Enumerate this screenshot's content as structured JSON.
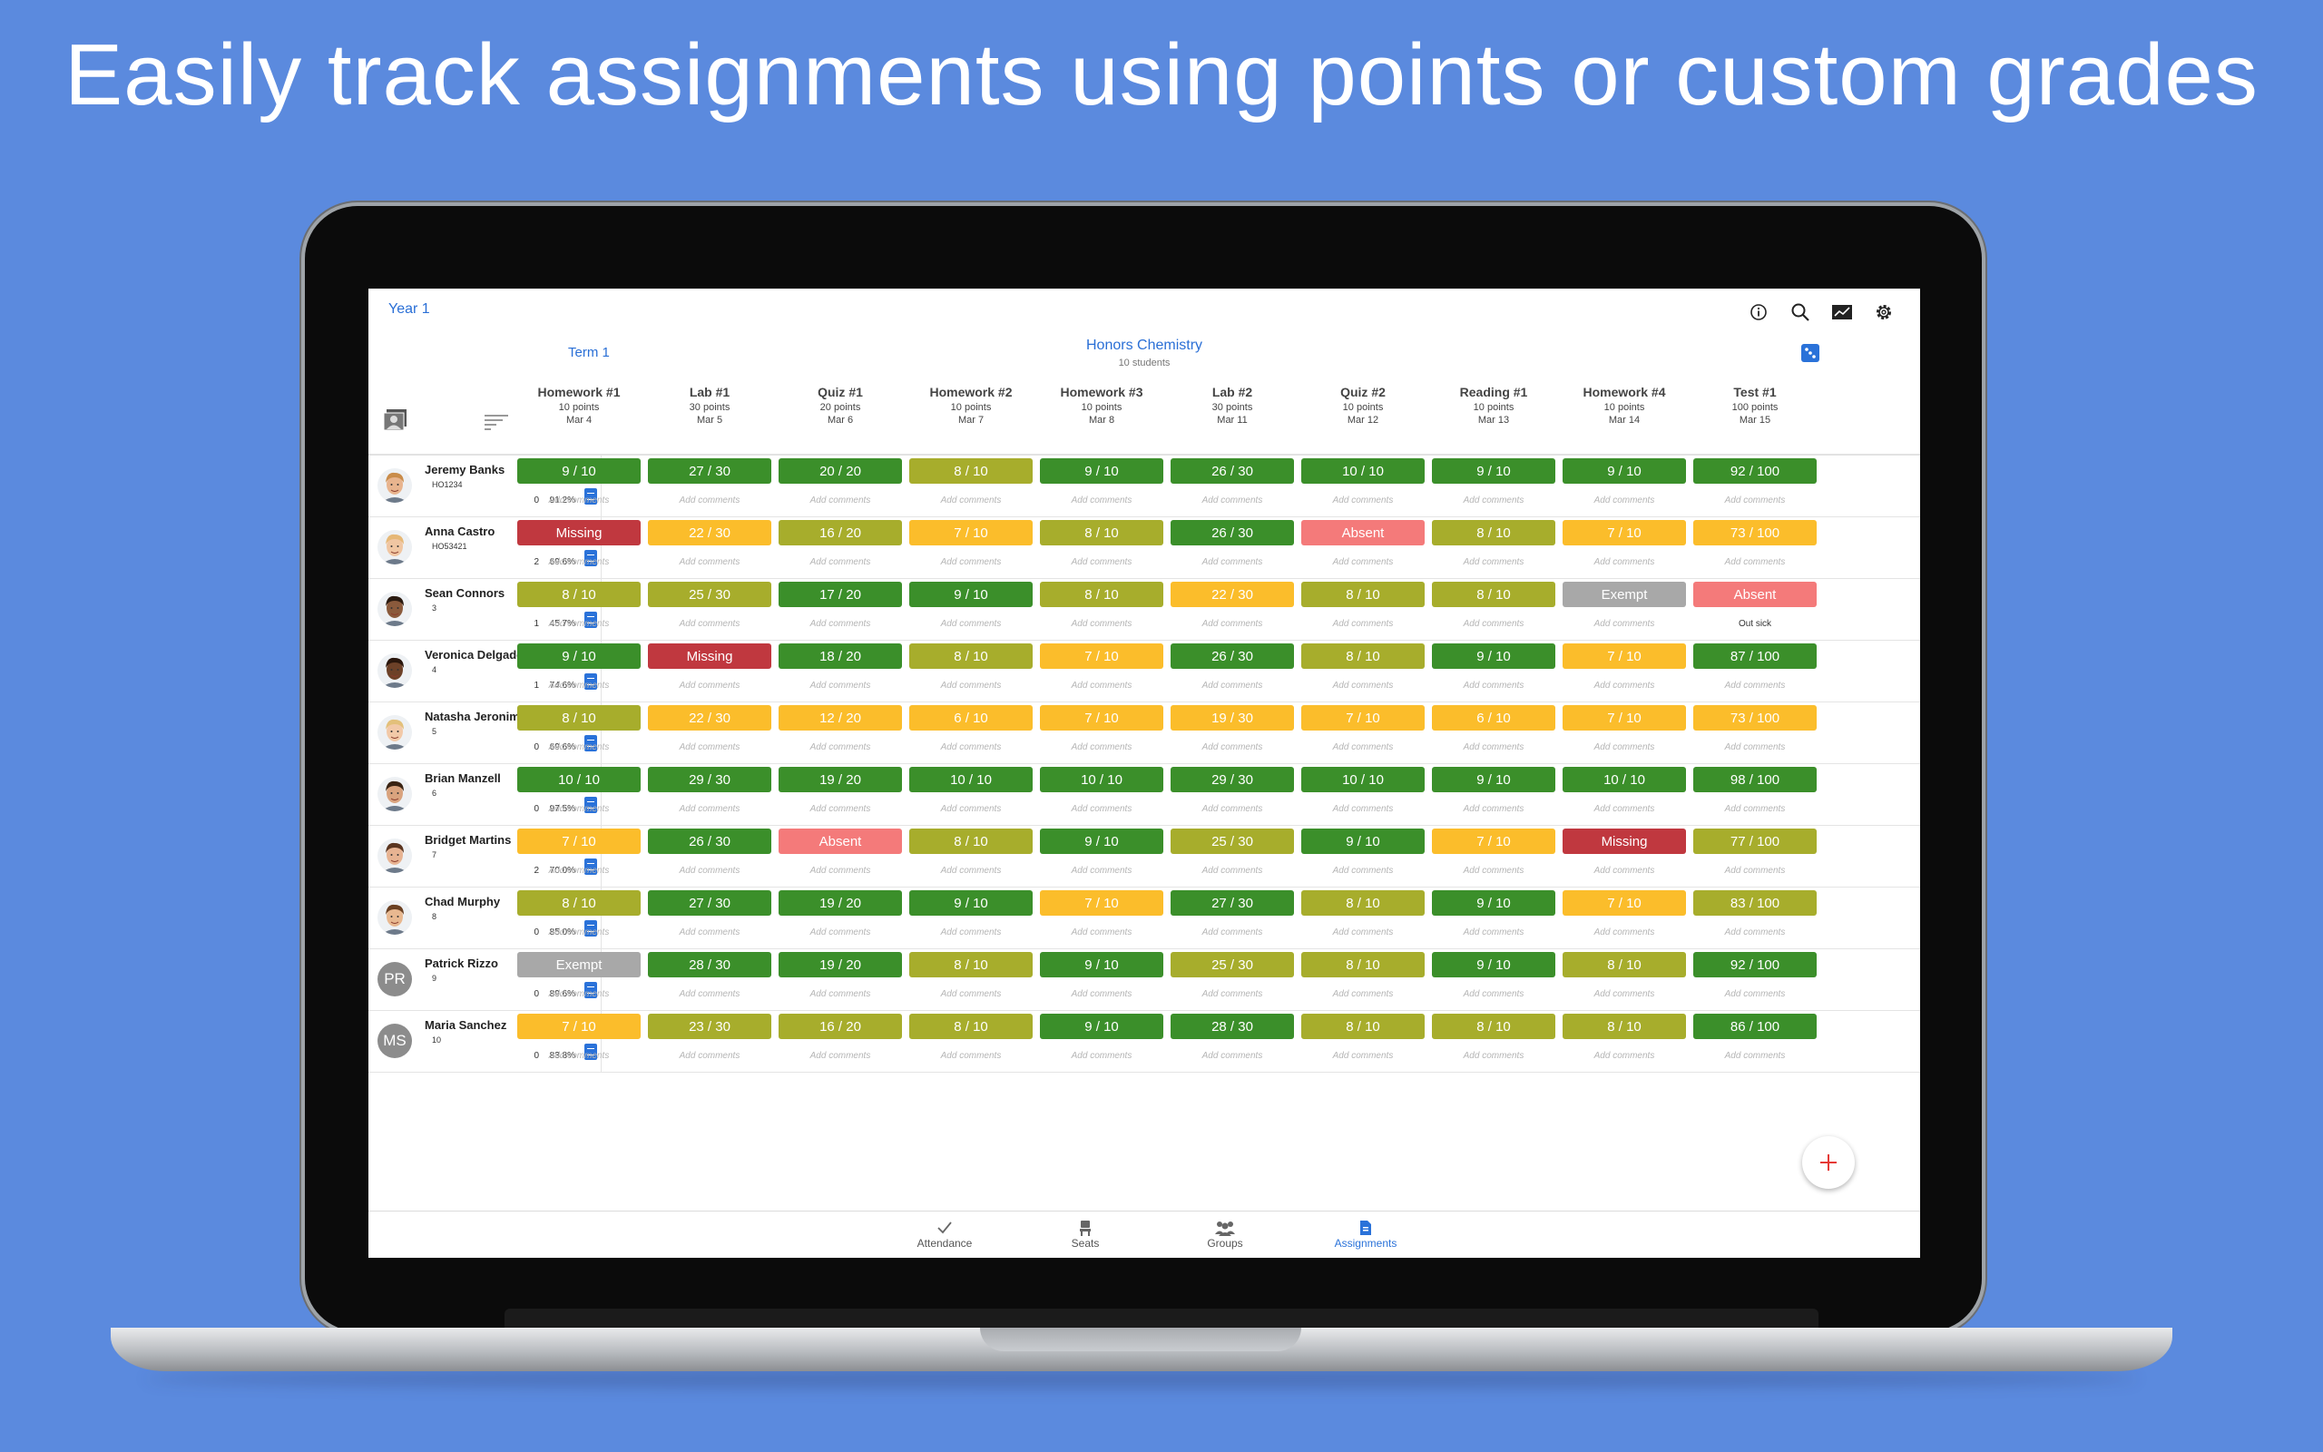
{
  "headline": "Easily track assignments using points or custom grades",
  "colors": {
    "green": "#3b8f2a",
    "olive": "#a7ad2c",
    "yellow": "#fbbd2b",
    "red": "#c0383f",
    "pink": "#f47a7a",
    "gray": "#a8a8a8",
    "accent": "#2a72d9"
  },
  "app": {
    "year": "Year 1",
    "term": "Term 1",
    "class_name": "Honors Chemistry",
    "class_count": "10 students",
    "top_icons": [
      "info-icon",
      "search-icon",
      "chart-icon",
      "gear-icon"
    ]
  },
  "assignments": [
    {
      "title": "Homework #1",
      "points": "10 points",
      "date": "Mar 4"
    },
    {
      "title": "Lab #1",
      "points": "30 points",
      "date": "Mar 5"
    },
    {
      "title": "Quiz #1",
      "points": "20 points",
      "date": "Mar 6"
    },
    {
      "title": "Homework #2",
      "points": "10 points",
      "date": "Mar 7"
    },
    {
      "title": "Homework #3",
      "points": "10 points",
      "date": "Mar 8"
    },
    {
      "title": "Lab #2",
      "points": "30 points",
      "date": "Mar 11"
    },
    {
      "title": "Quiz #2",
      "points": "10 points",
      "date": "Mar 12"
    },
    {
      "title": "Reading #1",
      "points": "10 points",
      "date": "Mar 13"
    },
    {
      "title": "Homework #4",
      "points": "10 points",
      "date": "Mar 14"
    },
    {
      "title": "Test #1",
      "points": "100 points",
      "date": "Mar 15"
    }
  ],
  "comment_placeholder": "Add comments",
  "students": [
    {
      "name": "Jeremy Banks",
      "id": "HO1234",
      "count": "0",
      "pct": "91.2%",
      "avatar": "photo",
      "skin": "#e8b48e",
      "hair": "#c98c4a",
      "grades": [
        [
          "9 / 10",
          "green"
        ],
        [
          "27 / 30",
          "green"
        ],
        [
          "20 / 20",
          "green"
        ],
        [
          "8 / 10",
          "olive"
        ],
        [
          "9 / 10",
          "green"
        ],
        [
          "26 / 30",
          "green"
        ],
        [
          "10 / 10",
          "green"
        ],
        [
          "9 / 10",
          "green"
        ],
        [
          "9 / 10",
          "green"
        ],
        [
          "92 / 100",
          "green"
        ]
      ],
      "comments": {}
    },
    {
      "name": "Anna Castro",
      "id": "HO53421",
      "count": "2",
      "pct": "69.6%",
      "avatar": "photo",
      "skin": "#f0c6a2",
      "hair": "#e6b877",
      "grades": [
        [
          "Missing",
          "red"
        ],
        [
          "22 / 30",
          "yellow"
        ],
        [
          "16 / 20",
          "olive"
        ],
        [
          "7 / 10",
          "yellow"
        ],
        [
          "8 / 10",
          "olive"
        ],
        [
          "26 / 30",
          "green"
        ],
        [
          "Absent",
          "pink"
        ],
        [
          "8 / 10",
          "olive"
        ],
        [
          "7 / 10",
          "yellow"
        ],
        [
          "73 / 100",
          "yellow"
        ]
      ],
      "comments": {}
    },
    {
      "name": "Sean Connors",
      "id": "3",
      "count": "1",
      "pct": "45.7%",
      "avatar": "photo",
      "skin": "#8a5a3c",
      "hair": "#2a1a10",
      "grades": [
        [
          "8 / 10",
          "olive"
        ],
        [
          "25 / 30",
          "olive"
        ],
        [
          "17 / 20",
          "green"
        ],
        [
          "9 / 10",
          "green"
        ],
        [
          "8 / 10",
          "olive"
        ],
        [
          "22 / 30",
          "yellow"
        ],
        [
          "8 / 10",
          "olive"
        ],
        [
          "8 / 10",
          "olive"
        ],
        [
          "Exempt",
          "gray"
        ],
        [
          "Absent",
          "pink"
        ]
      ],
      "comments": {
        "9": "Out sick"
      }
    },
    {
      "name": "Veronica Delgado",
      "id": "4",
      "count": "1",
      "pct": "74.6%",
      "avatar": "photo",
      "skin": "#6d4128",
      "hair": "#2a160c",
      "grades": [
        [
          "9 / 10",
          "green"
        ],
        [
          "Missing",
          "red"
        ],
        [
          "18 / 20",
          "green"
        ],
        [
          "8 / 10",
          "olive"
        ],
        [
          "7 / 10",
          "yellow"
        ],
        [
          "26 / 30",
          "green"
        ],
        [
          "8 / 10",
          "olive"
        ],
        [
          "9 / 10",
          "green"
        ],
        [
          "7 / 10",
          "yellow"
        ],
        [
          "87 / 100",
          "green"
        ]
      ],
      "comments": {}
    },
    {
      "name": "Natasha Jeronimo",
      "id": "5",
      "count": "0",
      "pct": "69.6%",
      "avatar": "photo",
      "skin": "#f2c9a8",
      "hair": "#e3c07a",
      "grades": [
        [
          "8 / 10",
          "olive"
        ],
        [
          "22 / 30",
          "yellow"
        ],
        [
          "12 / 20",
          "yellow"
        ],
        [
          "6 / 10",
          "yellow"
        ],
        [
          "7 / 10",
          "yellow"
        ],
        [
          "19 / 30",
          "yellow"
        ],
        [
          "7 / 10",
          "yellow"
        ],
        [
          "6 / 10",
          "yellow"
        ],
        [
          "7 / 10",
          "yellow"
        ],
        [
          "73 / 100",
          "yellow"
        ]
      ],
      "comments": {}
    },
    {
      "name": "Brian Manzell",
      "id": "6",
      "count": "0",
      "pct": "97.5%",
      "avatar": "photo",
      "skin": "#d9a37e",
      "hair": "#3a2414",
      "grades": [
        [
          "10 / 10",
          "green"
        ],
        [
          "29 / 30",
          "green"
        ],
        [
          "19 / 20",
          "green"
        ],
        [
          "10 / 10",
          "green"
        ],
        [
          "10 / 10",
          "green"
        ],
        [
          "29 / 30",
          "green"
        ],
        [
          "10 / 10",
          "green"
        ],
        [
          "9 / 10",
          "green"
        ],
        [
          "10 / 10",
          "green"
        ],
        [
          "98 / 100",
          "green"
        ]
      ],
      "comments": {}
    },
    {
      "name": "Bridget Martins",
      "id": "7",
      "count": "2",
      "pct": "70.0%",
      "avatar": "photo",
      "skin": "#e7b392",
      "hair": "#5a3520",
      "grades": [
        [
          "7 / 10",
          "yellow"
        ],
        [
          "26 / 30",
          "green"
        ],
        [
          "Absent",
          "pink"
        ],
        [
          "8 / 10",
          "olive"
        ],
        [
          "9 / 10",
          "green"
        ],
        [
          "25 / 30",
          "olive"
        ],
        [
          "9 / 10",
          "green"
        ],
        [
          "7 / 10",
          "yellow"
        ],
        [
          "Missing",
          "red"
        ],
        [
          "77 / 100",
          "olive"
        ]
      ],
      "comments": {}
    },
    {
      "name": "Chad Murphy",
      "id": "8",
      "count": "0",
      "pct": "85.0%",
      "avatar": "photo",
      "skin": "#e8b890",
      "hair": "#6a4022",
      "grades": [
        [
          "8 / 10",
          "olive"
        ],
        [
          "27 / 30",
          "green"
        ],
        [
          "19 / 20",
          "green"
        ],
        [
          "9 / 10",
          "green"
        ],
        [
          "7 / 10",
          "yellow"
        ],
        [
          "27 / 30",
          "green"
        ],
        [
          "8 / 10",
          "olive"
        ],
        [
          "9 / 10",
          "green"
        ],
        [
          "7 / 10",
          "yellow"
        ],
        [
          "83 / 100",
          "olive"
        ]
      ],
      "comments": {}
    },
    {
      "name": "Patrick Rizzo",
      "id": "9",
      "count": "0",
      "pct": "89.6%",
      "avatar": "initials",
      "initials": "PR",
      "grades": [
        [
          "Exempt",
          "gray"
        ],
        [
          "28 / 30",
          "green"
        ],
        [
          "19 / 20",
          "green"
        ],
        [
          "8 / 10",
          "olive"
        ],
        [
          "9 / 10",
          "green"
        ],
        [
          "25 / 30",
          "olive"
        ],
        [
          "8 / 10",
          "olive"
        ],
        [
          "9 / 10",
          "green"
        ],
        [
          "8 / 10",
          "olive"
        ],
        [
          "92 / 100",
          "green"
        ]
      ],
      "comments": {}
    },
    {
      "name": "Maria Sanchez",
      "id": "10",
      "count": "0",
      "pct": "83.8%",
      "avatar": "initials",
      "initials": "MS",
      "grades": [
        [
          "7 / 10",
          "yellow"
        ],
        [
          "23 / 30",
          "olive"
        ],
        [
          "16 / 20",
          "olive"
        ],
        [
          "8 / 10",
          "olive"
        ],
        [
          "9 / 10",
          "green"
        ],
        [
          "28 / 30",
          "green"
        ],
        [
          "8 / 10",
          "olive"
        ],
        [
          "8 / 10",
          "olive"
        ],
        [
          "8 / 10",
          "olive"
        ],
        [
          "86 / 100",
          "green"
        ]
      ],
      "comments": {}
    }
  ],
  "tabs": [
    {
      "label": "Attendance",
      "icon": "check-icon",
      "active": false
    },
    {
      "label": "Seats",
      "icon": "seat-icon",
      "active": false
    },
    {
      "label": "Groups",
      "icon": "groups-icon",
      "active": false
    },
    {
      "label": "Assignments",
      "icon": "assignments-icon",
      "active": true
    }
  ],
  "fab_icon": "plus-icon"
}
